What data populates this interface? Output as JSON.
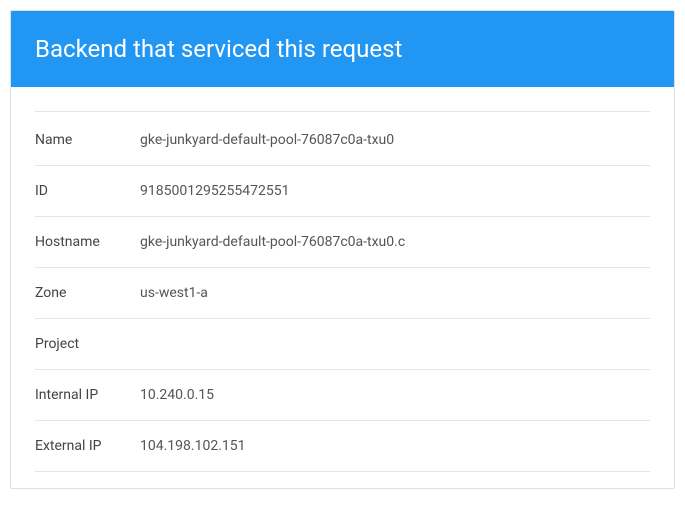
{
  "header": {
    "title": "Backend that serviced this request"
  },
  "rows": {
    "name_label": "Name",
    "name_value": "gke-junkyard-default-pool-76087c0a-txu0",
    "id_label": "ID",
    "id_value": "9185001295255472551",
    "hostname_label": "Hostname",
    "hostname_value": "gke-junkyard-default-pool-76087c0a-txu0.c",
    "zone_label": "Zone",
    "zone_value": "us-west1-a",
    "project_label": "Project",
    "project_value": "",
    "internal_ip_label": "Internal IP",
    "internal_ip_value": "10.240.0.15",
    "external_ip_label": "External IP",
    "external_ip_value": "104.198.102.151"
  }
}
